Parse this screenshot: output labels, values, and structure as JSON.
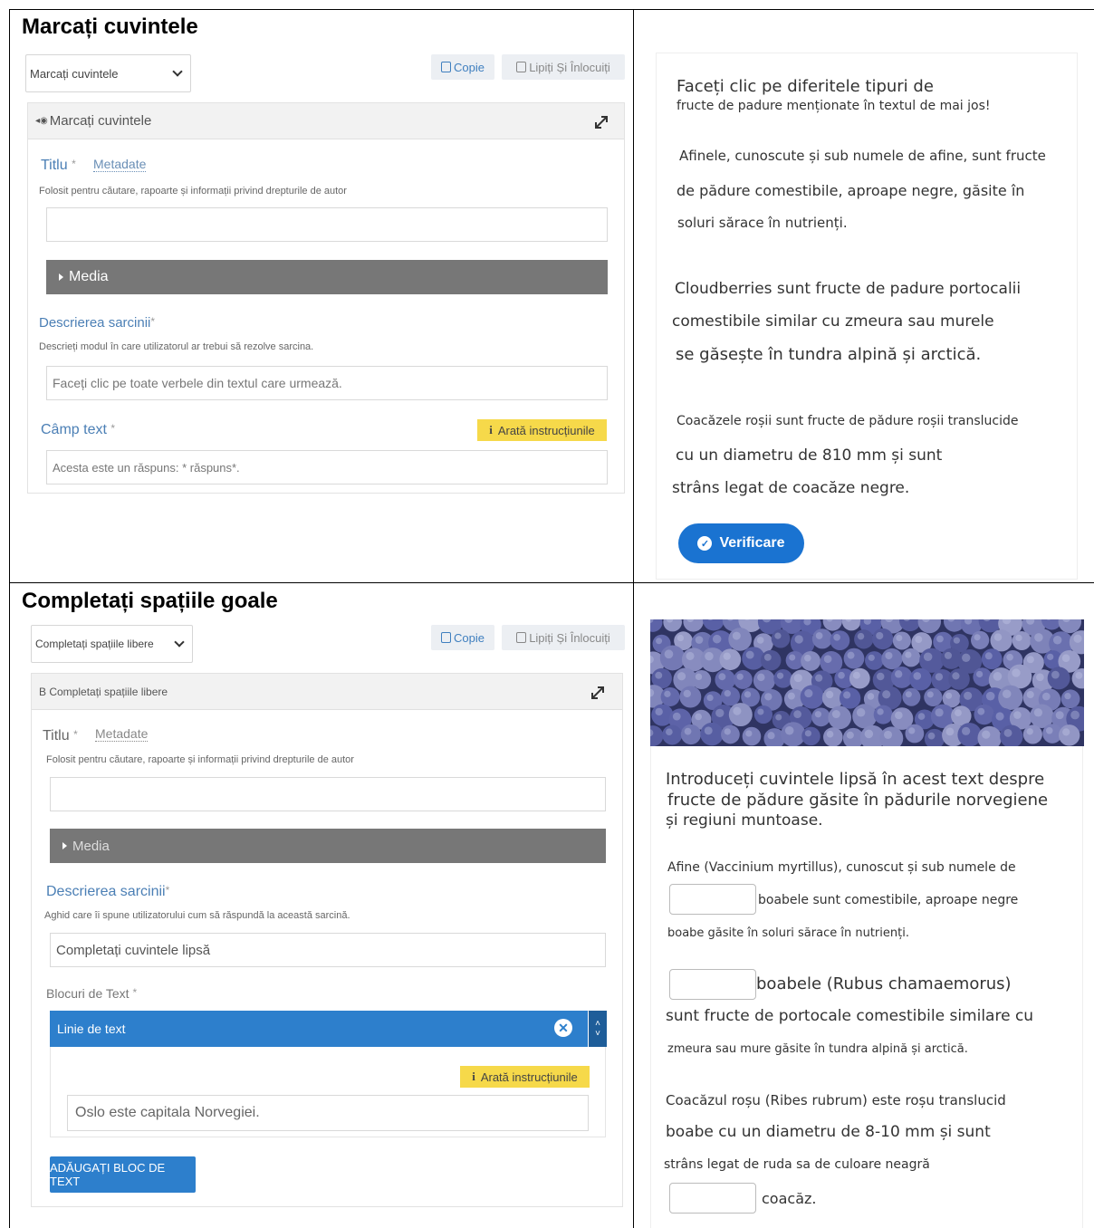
{
  "top": {
    "title": "Marcați cuvintele",
    "editor": {
      "dropdown_value": "Marcați cuvintele",
      "copy_label": "Copie",
      "paste_label": "Lipiți Și Înlocuiți",
      "panel_title": "Marcați cuvintele",
      "title_label": "Titlu",
      "required_mark": "*",
      "metadata_label": "Metadate",
      "title_help": "Folosit pentru căutare, rapoarte și informații privind drepturile de autor",
      "title_value": "",
      "media_label": "Media",
      "task_label": "Descrierea sarcinii",
      "task_help": "Descrieți modul în care utilizatorul ar trebui să rezolve sarcina.",
      "task_value": "Faceți clic pe toate verbele din textul care urmează.",
      "textfield_label": "Câmp text",
      "instructions_label": "Arată instrucțiunile",
      "textfield_value": "Acesta este un răspuns: * răspuns*."
    },
    "preview": {
      "heading_line1": "Faceți clic pe diferitele tipuri de",
      "heading_line2": "fructe de padure menționate în textul de mai jos!",
      "p1_line1": "Afinele, cunoscute și sub numele de afine, sunt fructe",
      "p1_line2": "de pădure comestibile, aproape negre, găsite în",
      "p1_line3": "soluri sărace în nutrienți.",
      "p2_line1": "Cloudberries sunt fructe de padure portocalii",
      "p2_line2": "comestibile similar cu zmeura sau murele",
      "p2_line3": "se găsește în tundra alpină și arctică.",
      "p3_line1": "Coacăzele roșii sunt fructe de pădure roșii translucide",
      "p3_line2": "cu un diametru de 810 mm și sunt",
      "p3_line3": "strâns legat de coacăze negre.",
      "verify_label": "Verificare"
    }
  },
  "bottom": {
    "title": "Completați spațiile goale",
    "editor": {
      "dropdown_value": "Completați spațiile libere",
      "copy_label": "Copie",
      "paste_label": "Lipiți Și Înlocuiți",
      "panel_title": "B Completați spațiile libere",
      "title_label": "Titlu",
      "required_mark": "*",
      "metadata_label": "Metadate",
      "title_help": "Folosit pentru căutare, rapoarte și informații privind drepturile de autor",
      "title_value": "",
      "media_label": "Media",
      "task_label": "Descrierea sarcinii",
      "task_help": "Aghid care îi spune utilizatorului cum să răspundă la această sarcină.",
      "task_value": "Completați cuvintele lipsă",
      "blocks_label": "Blocuri de Text",
      "line_label": "Linie de text",
      "instructions_label": "Arată instrucțiunile",
      "line_value": "Oslo este capitala Norvegiei.",
      "add_block_label": "ADĂUGAȚI BLOC DE TEXT"
    },
    "preview": {
      "intro_line1": "Introduceți cuvintele lipsă în acest text despre",
      "intro_line2": "fructe de pădure găsite în pădurile norvegiene",
      "intro_line3": "și regiuni muntoase.",
      "s1_line1": "Afine (Vaccinium myrtillus), cunoscut și sub numele de",
      "s1_line2": "boabele sunt comestibile, aproape negre",
      "s1_line3": "boabe găsite în soluri sărace în nutrienți.",
      "s2_line1": "boabele (Rubus chamaemorus)",
      "s2_line2": "sunt fructe de portocale comestibile similare cu",
      "s2_line3": "zmeura sau mure găsite în tundra alpină și arctică.",
      "s3_line1": "Coacăzul roșu (Ribes rubrum) este roșu translucid",
      "s3_line2": "boabe cu un diametru de 8-10 mm și sunt",
      "s3_line3": "strâns legat de ruda sa de culoare neagră",
      "s3_line4": "coacăz."
    }
  }
}
